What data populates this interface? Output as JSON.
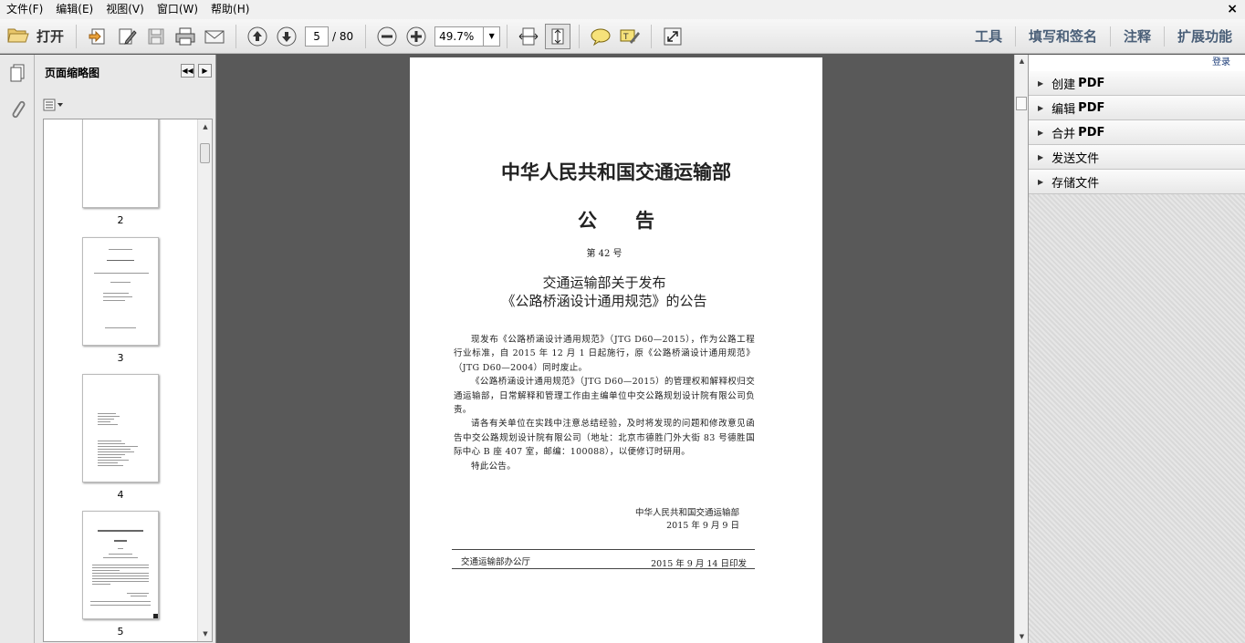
{
  "menu": {
    "file": "文件(F)",
    "edit": "编辑(E)",
    "view": "视图(V)",
    "window": "窗口(W)",
    "help": "帮助(H)",
    "close": "×"
  },
  "toolbar": {
    "open_label": "打开",
    "current_page": "5",
    "total_pages": "/ 80",
    "zoom": "49.7%",
    "tools_label": "工具",
    "fill_sign_label": "填写和签名",
    "comment_label": "注释",
    "extended_label": "扩展功能"
  },
  "thumbnails": {
    "title": "页面缩略图",
    "pages": [
      "2",
      "3",
      "4",
      "5"
    ]
  },
  "document": {
    "title_ministry": "中华人民共和国交通运输部",
    "title_notice": "公　　告",
    "notice_number": "第 42 号",
    "subtitle_1": "交通运输部关于发布",
    "subtitle_2": "《公路桥涵设计通用规范》的公告",
    "para_1": "现发布《公路桥涵设计通用规范》（JTG D60—2015），作为公路工程行业标准，自 2015 年 12 月 1 日起施行，原《公路桥涵设计通用规范》（JTG D60—2004）同时废止。",
    "para_2": "《公路桥涵设计通用规范》（JTG D60—2015）的管理权和解释权归交通运输部，日常解释和管理工作由主编单位中交公路规划设计院有限公司负责。",
    "para_3": "请各有关单位在实践中注意总结经验，及时将发现的问题和修改意见函告中交公路规划设计院有限公司（地址：北京市德胜门外大街 83 号德胜国际中心 B 座 407 室，邮编：100088），以便修订时研用。",
    "para_4": "特此公告。",
    "signature_org": "中华人民共和国交通运输部",
    "signature_date": "2015 年 9 月 9 日",
    "footer_left": "交通运输部办公厅",
    "footer_right": "2015 年 9 月 14 日印发"
  },
  "taskpane": {
    "login": "登录",
    "panels": [
      {
        "prefix": "创建",
        "suffix": "PDF"
      },
      {
        "prefix": "编辑",
        "suffix": "PDF"
      },
      {
        "prefix": "合并",
        "suffix": "PDF"
      },
      {
        "prefix": "发送文件",
        "suffix": ""
      },
      {
        "prefix": "存储文件",
        "suffix": ""
      }
    ]
  }
}
